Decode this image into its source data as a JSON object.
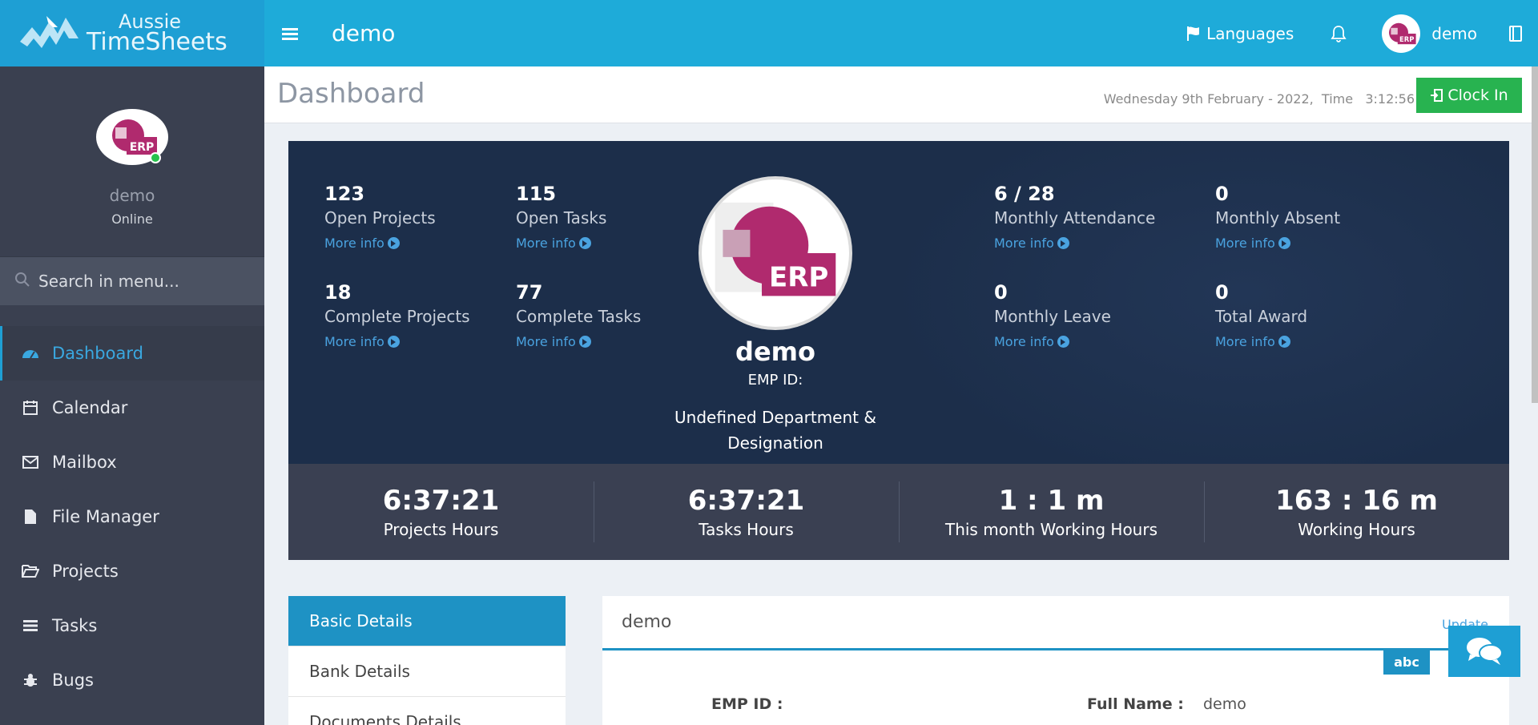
{
  "app": {
    "logo_line1": "Aussie",
    "logo_line2": "TimeSheets",
    "brand_color": "#1e9fd4"
  },
  "sidebar": {
    "user_name": "demo",
    "user_status": "Online",
    "search_placeholder": "Search in menu...",
    "items": [
      {
        "label": "Dashboard",
        "icon": "dashboard-icon",
        "active": true
      },
      {
        "label": "Calendar",
        "icon": "calendar-icon"
      },
      {
        "label": "Mailbox",
        "icon": "envelope-icon"
      },
      {
        "label": "File Manager",
        "icon": "file-icon"
      },
      {
        "label": "Projects",
        "icon": "folder-open-icon"
      },
      {
        "label": "Tasks",
        "icon": "tasks-icon"
      },
      {
        "label": "Bugs",
        "icon": "bug-icon"
      }
    ]
  },
  "topbar": {
    "title": "demo",
    "languages_label": "Languages",
    "user_name": "demo"
  },
  "header": {
    "page_title": "Dashboard",
    "datetime": "Wednesday 9th February - 2022,  Time   3:12:56",
    "clock_in_label": "Clock In"
  },
  "hero": {
    "stats": [
      {
        "value": "123",
        "label": "Open Projects",
        "more": "More info"
      },
      {
        "value": "115",
        "label": "Open Tasks",
        "more": "More info"
      },
      {
        "value": "18",
        "label": "Complete Projects",
        "more": "More info"
      },
      {
        "value": "77",
        "label": "Complete Tasks",
        "more": "More info"
      },
      {
        "value": "6 / 28",
        "label": "Monthly Attendance",
        "more": "More info"
      },
      {
        "value": "0",
        "label": "Monthly Absent",
        "more": "More info"
      },
      {
        "value": "0",
        "label": "Monthly Leave",
        "more": "More info"
      },
      {
        "value": "0",
        "label": "Total Award",
        "more": "More info"
      }
    ],
    "profile_name": "demo",
    "emp_id_label": "EMP ID:",
    "department": "Undefined Department & Designation"
  },
  "hours": [
    {
      "value": "6:37:21",
      "label": "Projects Hours"
    },
    {
      "value": "6:37:21",
      "label": "Tasks Hours"
    },
    {
      "value": "1 : 1 m",
      "label": "This month Working Hours"
    },
    {
      "value": "163 : 16 m",
      "label": "Working Hours"
    }
  ],
  "detail_tabs": [
    {
      "label": "Basic Details",
      "active": true
    },
    {
      "label": "Bank Details"
    },
    {
      "label": "Documents Details"
    }
  ],
  "detail_card": {
    "title": "demo",
    "update_label": "Update",
    "badge": "abc",
    "emp_id_label": "EMP ID :",
    "emp_id_value": "",
    "full_name_label": "Full Name :",
    "full_name_value": "demo"
  }
}
